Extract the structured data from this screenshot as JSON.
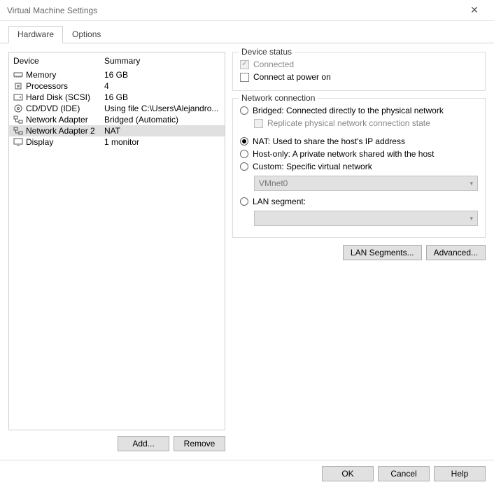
{
  "window": {
    "title": "Virtual Machine Settings"
  },
  "tabs": {
    "hardware": "Hardware",
    "options": "Options"
  },
  "deviceList": {
    "headDevice": "Device",
    "headSummary": "Summary",
    "rows": [
      {
        "name": "Memory",
        "summary": "16 GB"
      },
      {
        "name": "Processors",
        "summary": "4"
      },
      {
        "name": "Hard Disk (SCSI)",
        "summary": "16 GB"
      },
      {
        "name": "CD/DVD (IDE)",
        "summary": "Using file C:\\Users\\Alejandro..."
      },
      {
        "name": "Network Adapter",
        "summary": "Bridged (Automatic)"
      },
      {
        "name": "Network Adapter 2",
        "summary": "NAT"
      },
      {
        "name": "Display",
        "summary": "1 monitor"
      }
    ],
    "addBtn": "Add...",
    "removeBtn": "Remove"
  },
  "deviceStatus": {
    "legend": "Device status",
    "connected": "Connected",
    "powerOn": "Connect at power on"
  },
  "netConn": {
    "legend": "Network connection",
    "bridged": "Bridged: Connected directly to the physical network",
    "replicate": "Replicate physical network connection state",
    "nat": "NAT: Used to share the host's IP address",
    "hostOnly": "Host-only: A private network shared with the host",
    "custom": "Custom: Specific virtual network",
    "customCombo": "VMnet0",
    "lanSeg": "LAN segment:",
    "lanBtn": "LAN Segments...",
    "advBtn": "Advanced..."
  },
  "footer": {
    "ok": "OK",
    "cancel": "Cancel",
    "help": "Help"
  }
}
